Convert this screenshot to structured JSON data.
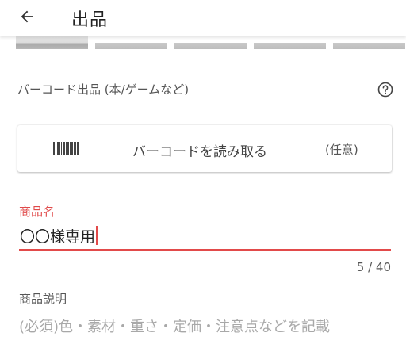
{
  "app": {
    "title": "出品"
  },
  "colors": {
    "accent": "#e24a4a",
    "label": "#555555",
    "placeholder": "#a8a8a8"
  },
  "icons": {
    "back": "arrow-left-icon",
    "help": "question-circle-icon",
    "barcode": "barcode-icon"
  },
  "barcode_section": {
    "label": "バーコード出品 (本/ゲームなど)",
    "button_label": "バーコードを読み取る",
    "optional": "(任意)"
  },
  "product_name": {
    "label": "商品名",
    "value": "〇〇様専用",
    "count": "5 / 40"
  },
  "description": {
    "label": "商品説明",
    "placeholder": "(必須)色・素材・重さ・定価・注意点などを記載"
  }
}
